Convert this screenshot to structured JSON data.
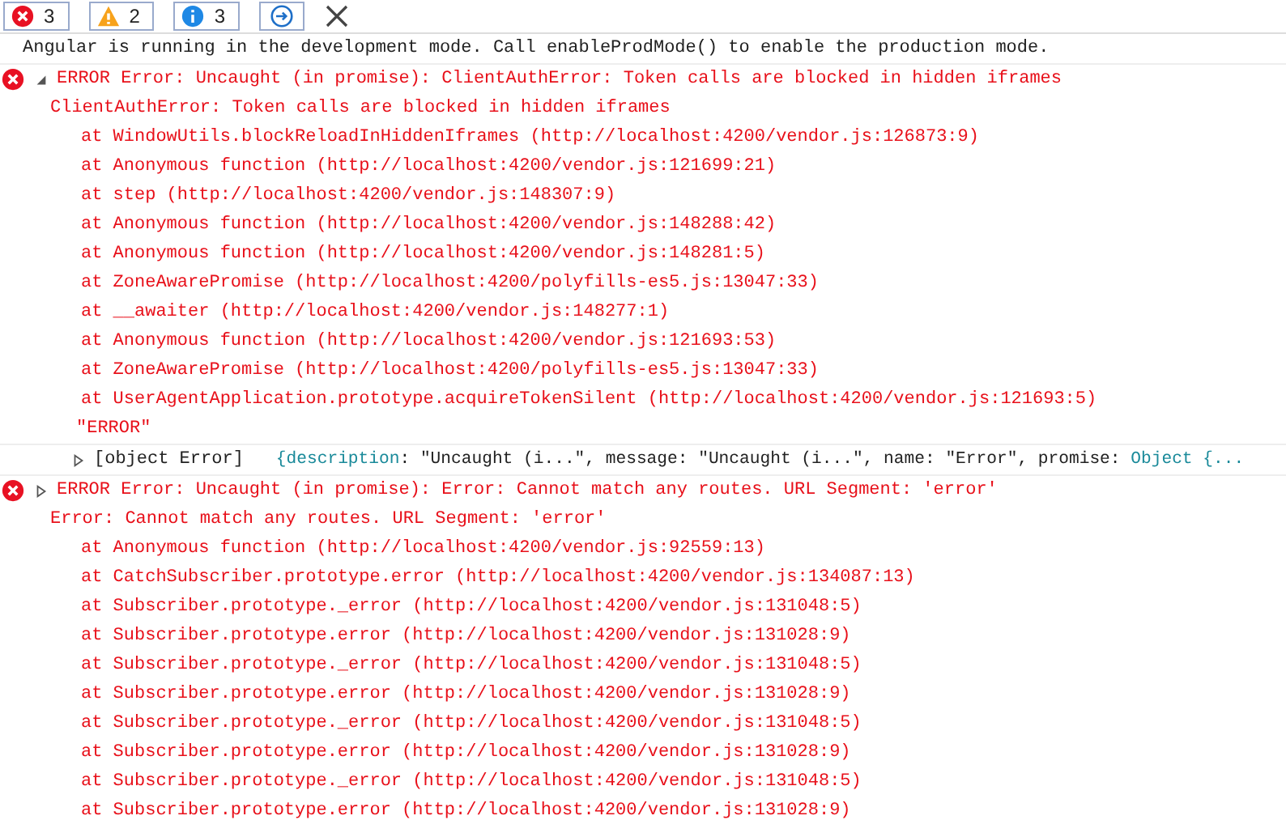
{
  "toolbar": {
    "filters": [
      {
        "kind": "error",
        "count": "3"
      },
      {
        "kind": "warning",
        "count": "2"
      },
      {
        "kind": "info",
        "count": "3"
      }
    ]
  },
  "messages": [
    {
      "kind": "log",
      "text": "Angular is running in the development mode. Call enableProdMode() to enable the production mode."
    },
    {
      "kind": "error",
      "expanded": true,
      "title": "ERROR Error: Uncaught (in promise): ClientAuthError: Token calls are blocked in hidden iframes",
      "message": "ClientAuthError: Token calls are blocked in hidden iframes",
      "stack": [
        "at WindowUtils.blockReloadInHiddenIframes (http://localhost:4200/vendor.js:126873:9)",
        "at Anonymous function (http://localhost:4200/vendor.js:121699:21)",
        "at step (http://localhost:4200/vendor.js:148307:9)",
        "at Anonymous function (http://localhost:4200/vendor.js:148288:42)",
        "at Anonymous function (http://localhost:4200/vendor.js:148281:5)",
        "at ZoneAwarePromise (http://localhost:4200/polyfills-es5.js:13047:33)",
        "at __awaiter (http://localhost:4200/vendor.js:148277:1)",
        "at Anonymous function (http://localhost:4200/vendor.js:121693:53)",
        "at ZoneAwarePromise (http://localhost:4200/polyfills-es5.js:13047:33)",
        "at UserAgentApplication.prototype.acquireTokenSilent (http://localhost:4200/vendor.js:121693:5)"
      ],
      "extra": "\"ERROR\"",
      "object": {
        "expanded": false,
        "label": "[object Error]",
        "preview": [
          {
            "text": "{description",
            "kind": "brace"
          },
          {
            "text": ": ",
            "kind": "punct"
          },
          {
            "text": "\"Uncaught (i...\"",
            "kind": "string"
          },
          {
            "text": ", message",
            "kind": "key"
          },
          {
            "text": ": ",
            "kind": "punct"
          },
          {
            "text": "\"Uncaught (i...\"",
            "kind": "string"
          },
          {
            "text": ", name",
            "kind": "key"
          },
          {
            "text": ": ",
            "kind": "punct"
          },
          {
            "text": "\"Error\"",
            "kind": "string"
          },
          {
            "text": ", promise",
            "kind": "key"
          },
          {
            "text": ": ",
            "kind": "punct"
          },
          {
            "text": "Object {...",
            "kind": "object"
          }
        ]
      }
    },
    {
      "kind": "error",
      "expanded": false,
      "title": "ERROR Error: Uncaught (in promise): Error: Cannot match any routes. URL Segment: 'error'",
      "message": "Error: Cannot match any routes. URL Segment: 'error'",
      "stack": [
        "at Anonymous function (http://localhost:4200/vendor.js:92559:13)",
        "at CatchSubscriber.prototype.error (http://localhost:4200/vendor.js:134087:13)",
        "at Subscriber.prototype._error (http://localhost:4200/vendor.js:131048:5)",
        "at Subscriber.prototype.error (http://localhost:4200/vendor.js:131028:9)",
        "at Subscriber.prototype._error (http://localhost:4200/vendor.js:131048:5)",
        "at Subscriber.prototype.error (http://localhost:4200/vendor.js:131028:9)",
        "at Subscriber.prototype._error (http://localhost:4200/vendor.js:131048:5)",
        "at Subscriber.prototype.error (http://localhost:4200/vendor.js:131028:9)",
        "at Subscriber.prototype._error (http://localhost:4200/vendor.js:131048:5)",
        "at Subscriber.prototype.error (http://localhost:4200/vendor.js:131028:9)"
      ]
    }
  ]
}
